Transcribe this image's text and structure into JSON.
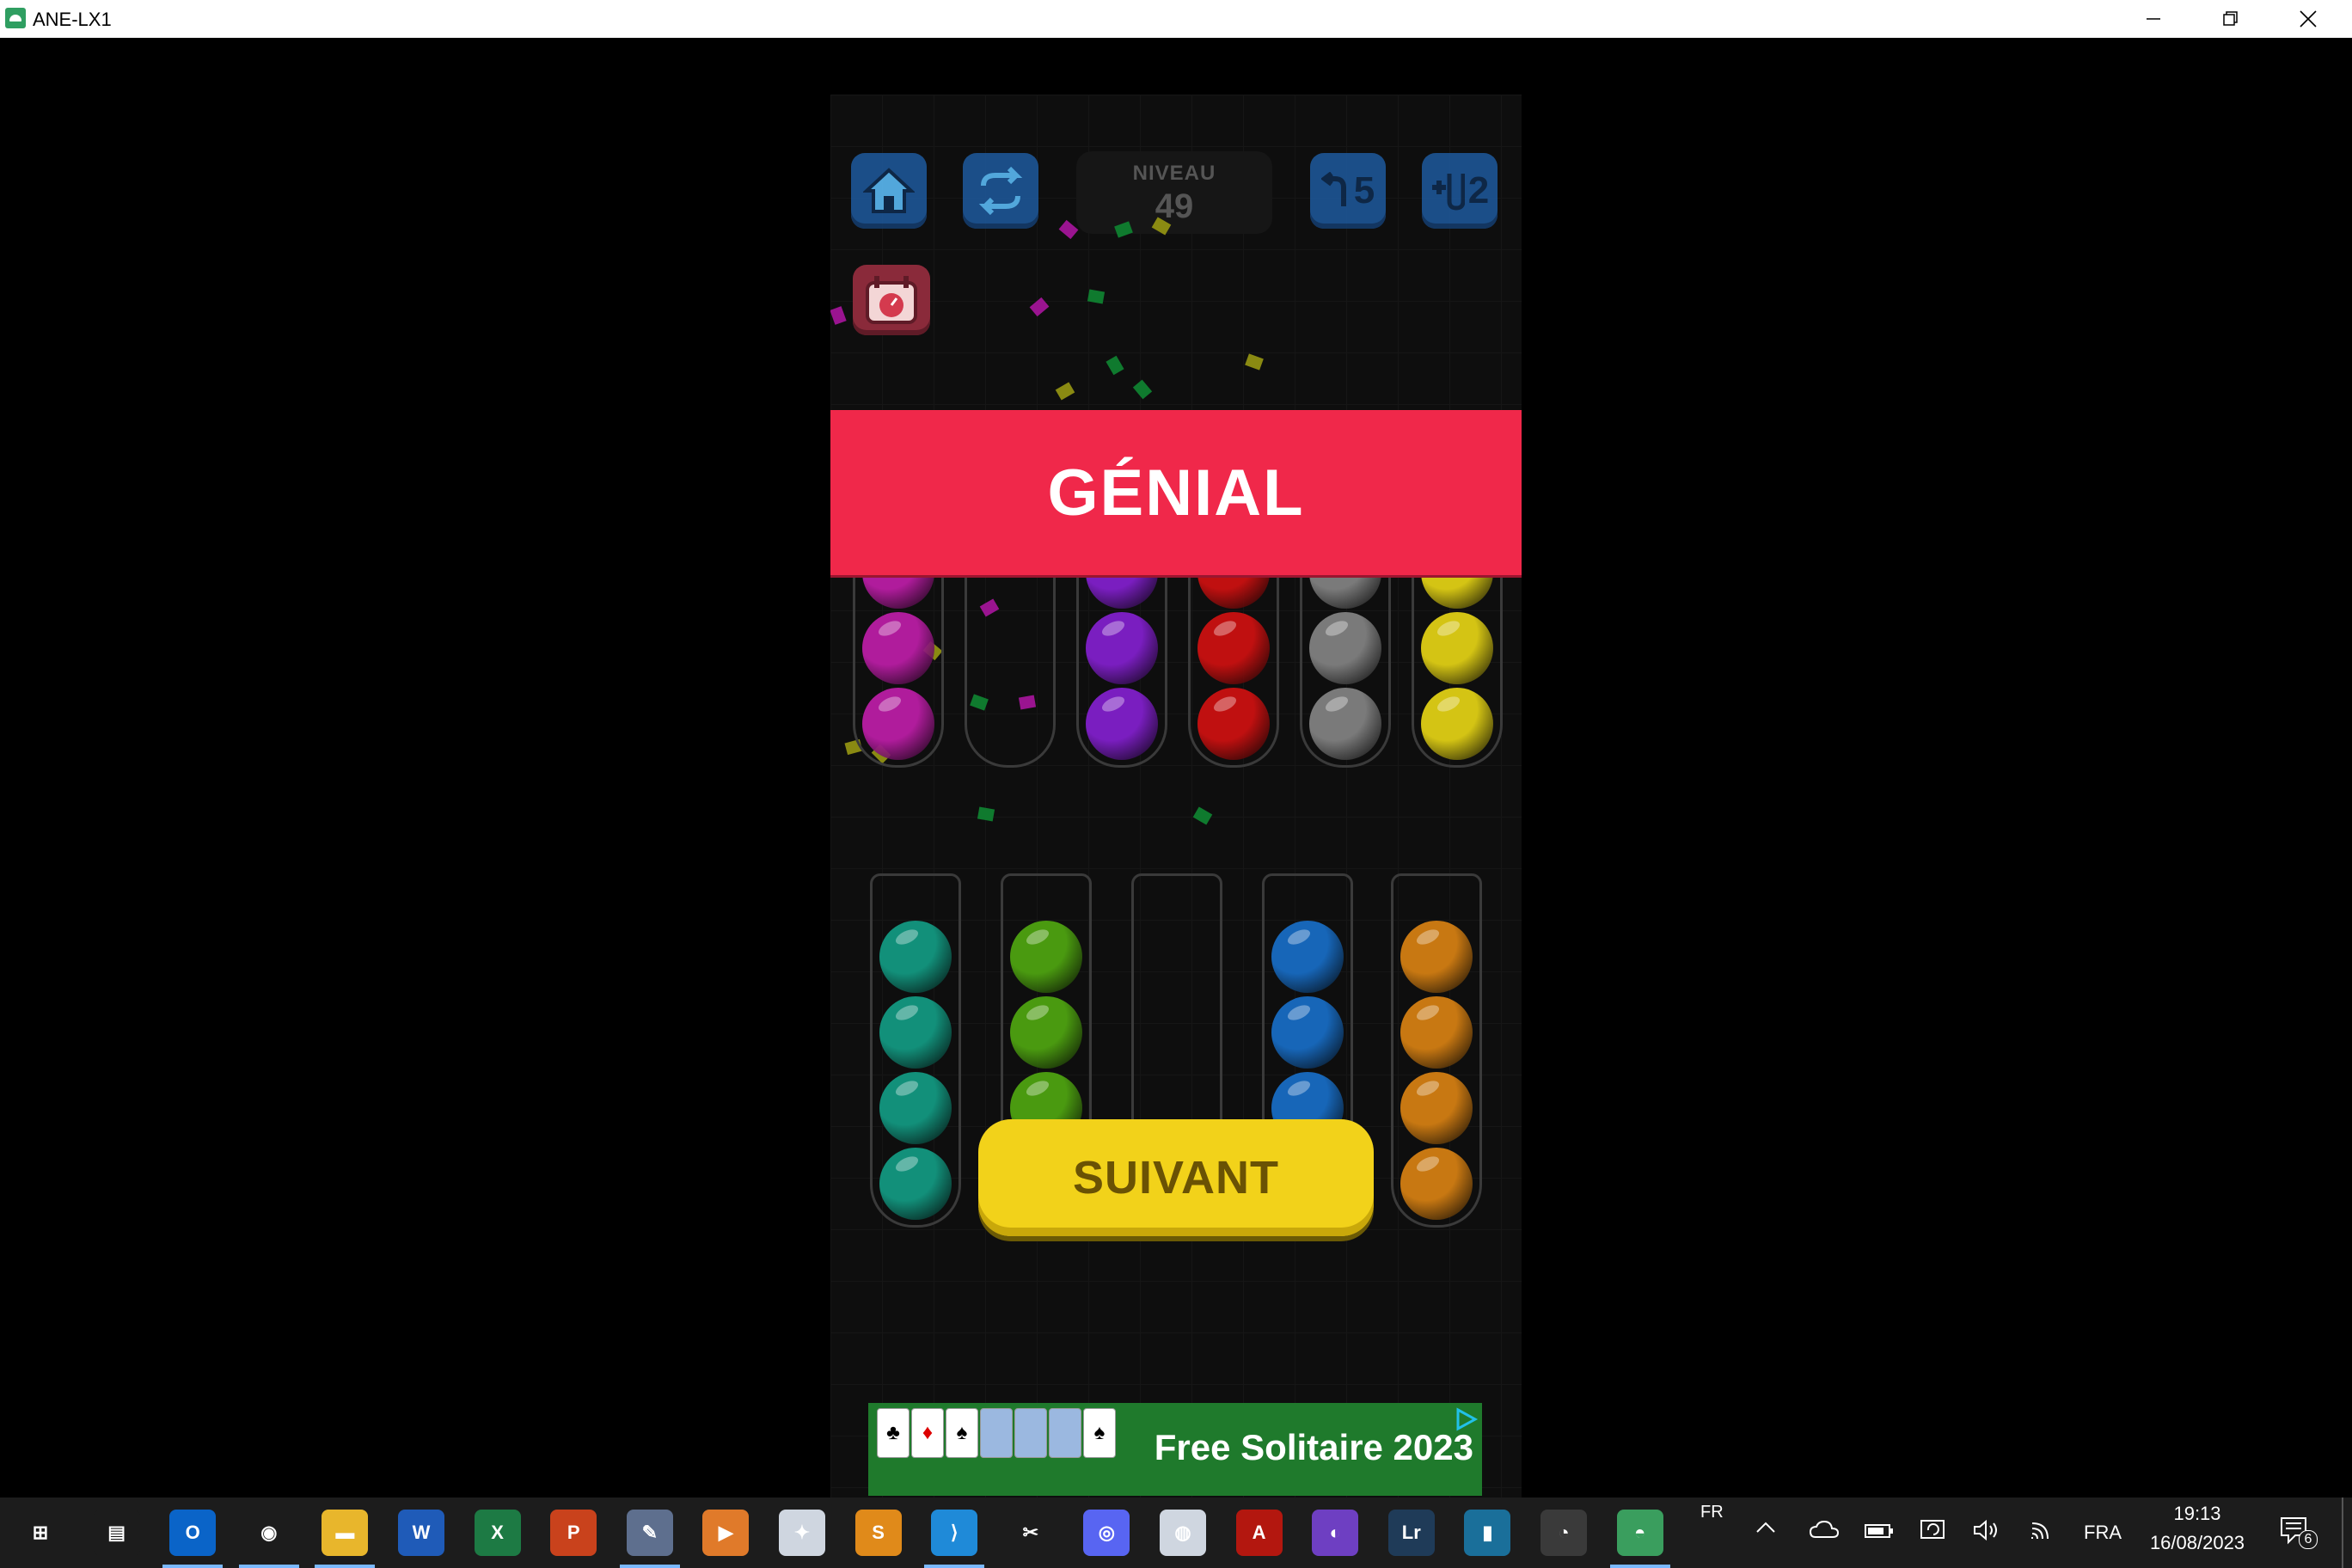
{
  "window": {
    "title": "ANE-LX1",
    "minimize_icon": "minimize-icon",
    "restore_icon": "restore-icon",
    "close_icon": "close-icon"
  },
  "game": {
    "level_label": "NIVEAU",
    "level_number": "49",
    "undo_count": "5",
    "add_tube_count": "2",
    "banner_text": "GÉNIAL",
    "next_label": "SUIVANT",
    "colors": {
      "magenta": "#b01c9c",
      "purple": "#7a1ec0",
      "red": "#c01010",
      "gray": "#7a7a7a",
      "yellow": "#d4c414",
      "teal": "#12907a",
      "green": "#4a9a10",
      "blue": "#1766b8",
      "orange": "#c87812",
      "banner": "#f0284a",
      "next_button": "#f2d21a"
    },
    "top_row_tubes": [
      [
        "magenta",
        "magenta",
        "magenta"
      ],
      [],
      [
        "purple",
        "purple",
        "purple"
      ],
      [
        "red",
        "red",
        "red"
      ],
      [
        "gray",
        "gray",
        "gray"
      ],
      [
        "yellow",
        "yellow",
        "yellow"
      ]
    ],
    "bottom_row_tubes": [
      [
        "teal",
        "teal",
        "teal",
        "teal"
      ],
      [
        "green",
        "green",
        "green",
        "green"
      ],
      [],
      [
        "blue",
        "blue",
        "blue",
        "blue"
      ],
      [
        "orange",
        "orange",
        "orange",
        "orange"
      ]
    ]
  },
  "ad": {
    "text": "Free Solitaire 2023"
  },
  "taskbar": {
    "apps": [
      "windows-start",
      "task-view",
      "outlook",
      "chrome",
      "file-explorer",
      "word",
      "excel",
      "powerpoint",
      "snipping-tool",
      "media-player",
      "python-script",
      "sublime-text",
      "vs-code",
      "scissors-tool",
      "discord",
      "game-controller",
      "acrobat",
      "github-desktop",
      "lightroom-classic",
      "app-panel",
      "obs-studio",
      "android-emulator"
    ],
    "lang_indicator": "FR",
    "lang": "FRA",
    "time": "19:13",
    "date": "16/08/2023",
    "notification_count": "6"
  }
}
